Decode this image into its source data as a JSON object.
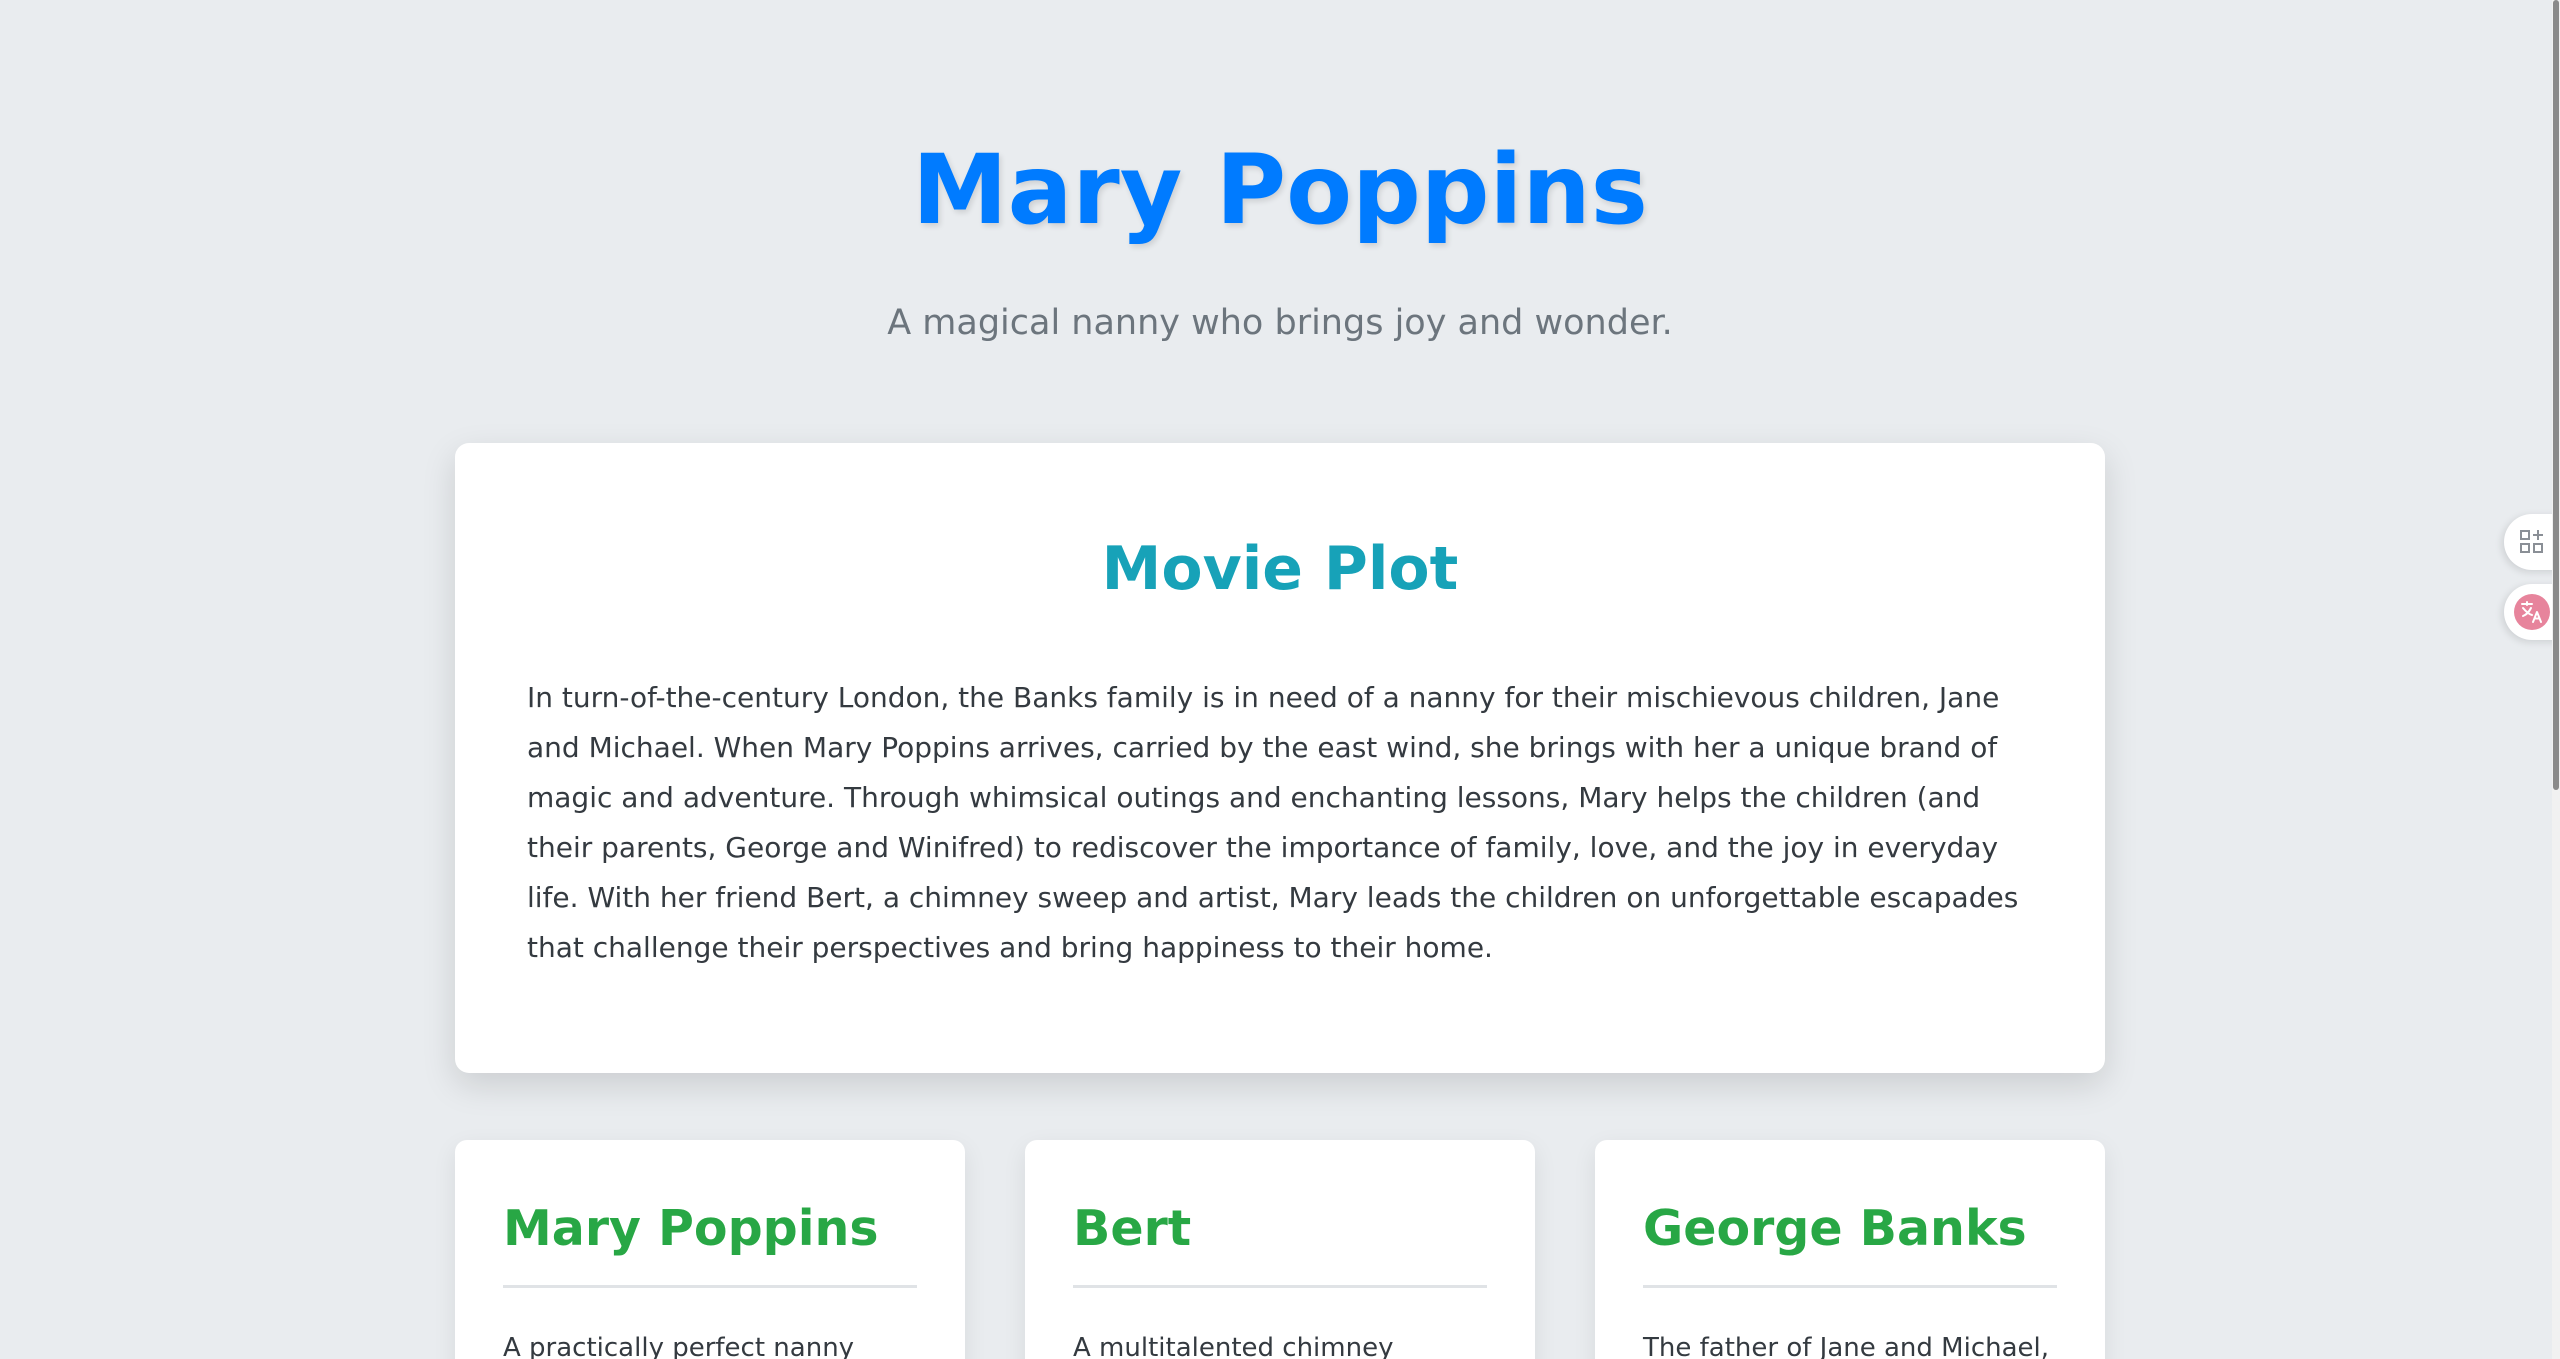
{
  "hero": {
    "title": "Mary Poppins",
    "subtitle": "A magical nanny who brings joy and wonder."
  },
  "plot": {
    "title": "Movie Plot",
    "text": "In turn-of-the-century London, the Banks family is in need of a nanny for their mischievous children, Jane and Michael. When Mary Poppins arrives, carried by the east wind, she brings with her a unique brand of magic and adventure. Through whimsical outings and enchanting lessons, Mary helps the children (and their parents, George and Winifred) to rediscover the importance of family, love, and the joy in everyday life. With her friend Bert, a chimney sweep and artist, Mary leads the children on unforgettable escapades that challenge their perspectives and bring happiness to their home."
  },
  "characters": [
    {
      "name": "Mary Poppins",
      "description": "A practically perfect nanny with"
    },
    {
      "name": "Bert",
      "description": "A multitalented chimney sweep,"
    },
    {
      "name": "George Banks",
      "description": "The father of Jane and Michael, a"
    }
  ],
  "side_tools": [
    {
      "icon": "grid-plus-icon"
    },
    {
      "icon": "translate-icon"
    }
  ],
  "colors": {
    "title": "#007bff",
    "plot_title": "#17a2b8",
    "character_name": "#28a745",
    "background": "#e9ecef"
  }
}
